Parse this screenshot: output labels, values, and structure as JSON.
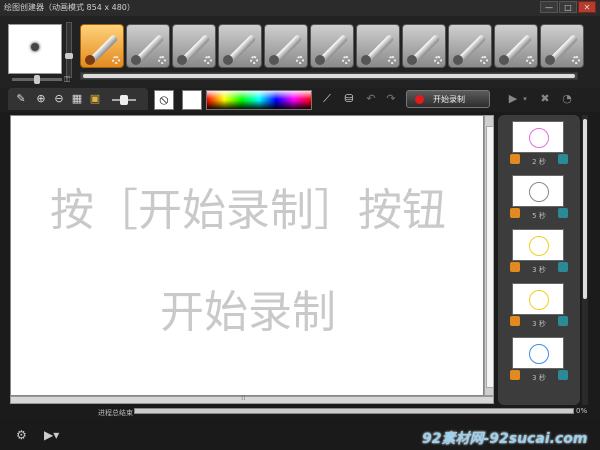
{
  "window": {
    "title": "绘图创建器（动画模式 854 x 480）",
    "minimize": "—",
    "maximize": "□",
    "close": "✕"
  },
  "tools": [
    {
      "name": "brush",
      "active": true
    },
    {
      "name": "airbrush",
      "active": false
    },
    {
      "name": "crayon",
      "active": false
    },
    {
      "name": "marker",
      "active": false
    },
    {
      "name": "eraser",
      "active": false
    },
    {
      "name": "pencil",
      "active": false
    },
    {
      "name": "paint-tube",
      "active": false
    },
    {
      "name": "pen",
      "active": false
    },
    {
      "name": "stamp",
      "active": false
    },
    {
      "name": "fountain-pen",
      "active": false
    },
    {
      "name": "brush-2",
      "active": false
    }
  ],
  "toolbar2": {
    "icons": [
      "edit-icon",
      "zoom-in-icon",
      "zoom-out-icon",
      "fit-icon",
      "layer-icon"
    ],
    "no_color": "⦸",
    "record_label": "开始录制"
  },
  "canvas": {
    "hint_line1": "按［开始录制］按钮",
    "hint_line2": "开始录制"
  },
  "frames": [
    {
      "label": "2 秒"
    },
    {
      "label": "5 秒"
    },
    {
      "label": "3 秒"
    },
    {
      "label": "3 秒"
    },
    {
      "label": "3 秒"
    }
  ],
  "status": {
    "label": "进程总结束",
    "progress": 0,
    "percent": "0%"
  },
  "watermark": "92素材网-92sucai.com",
  "colors": {
    "accent_orange": "#e38b1f",
    "record_red": "#e51b1b",
    "frame_blue": "#2b8a98"
  }
}
